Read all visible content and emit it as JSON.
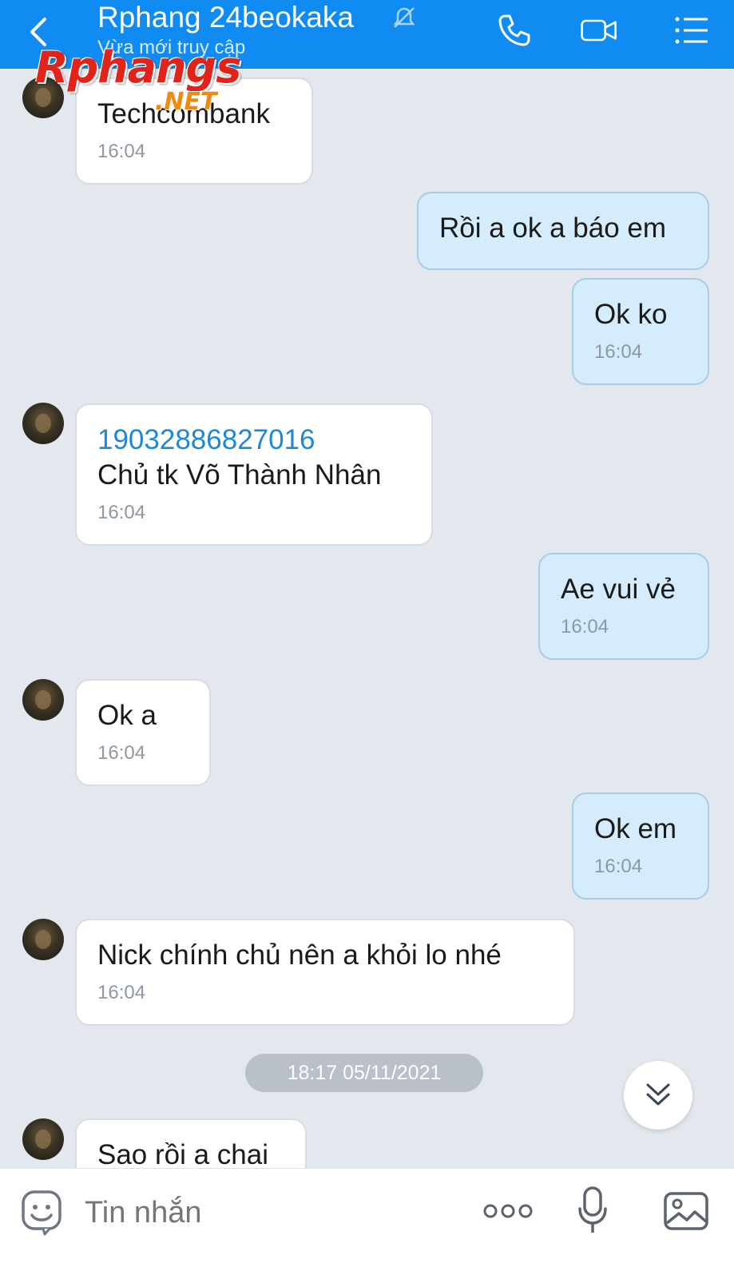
{
  "header": {
    "title": "Rphang 24beokaka",
    "subtitle": "Vừa mới truy cập",
    "icons": [
      "back-icon",
      "muted-bell-icon",
      "phone-icon",
      "video-icon",
      "menu-icon"
    ],
    "background": "#0f8bf2"
  },
  "watermark": {
    "main": "Rphangs",
    "sub": ".NET"
  },
  "messages": [
    {
      "side": "in",
      "lines": [
        "Techcombank"
      ],
      "time": "16:04"
    },
    {
      "side": "out",
      "lines": [
        "Rồi a ok a báo em"
      ],
      "time": ""
    },
    {
      "side": "out",
      "lines": [
        "Ok ko"
      ],
      "time": "16:04"
    },
    {
      "side": "in",
      "link": "19032886827016",
      "lines": [
        "Chủ tk Võ Thành Nhân"
      ],
      "time": "16:04"
    },
    {
      "side": "out",
      "lines": [
        "Ae vui vẻ"
      ],
      "time": "16:04"
    },
    {
      "side": "in",
      "lines": [
        "Ok a"
      ],
      "time": "16:04"
    },
    {
      "side": "out",
      "lines": [
        "Ok em"
      ],
      "time": "16:04"
    },
    {
      "side": "in",
      "lines": [
        "Nick chính chủ nên a khỏi lo nhé"
      ],
      "time": "16:04"
    },
    {
      "side": "in",
      "lines": [
        "Sao rồi a chai"
      ],
      "time": ""
    }
  ],
  "date_separator": "18:17 05/11/2021",
  "composer": {
    "placeholder": "Tin nhắn",
    "icons": [
      "emoji-icon",
      "more-icon",
      "microphone-icon",
      "image-icon"
    ]
  },
  "colors": {
    "accent": "#0f8bf2",
    "incoming_bubble": "#ffffff",
    "outgoing_bubble": "#d4ecfb",
    "link": "#1e88d8",
    "chat_background": "#e3e8ef"
  }
}
